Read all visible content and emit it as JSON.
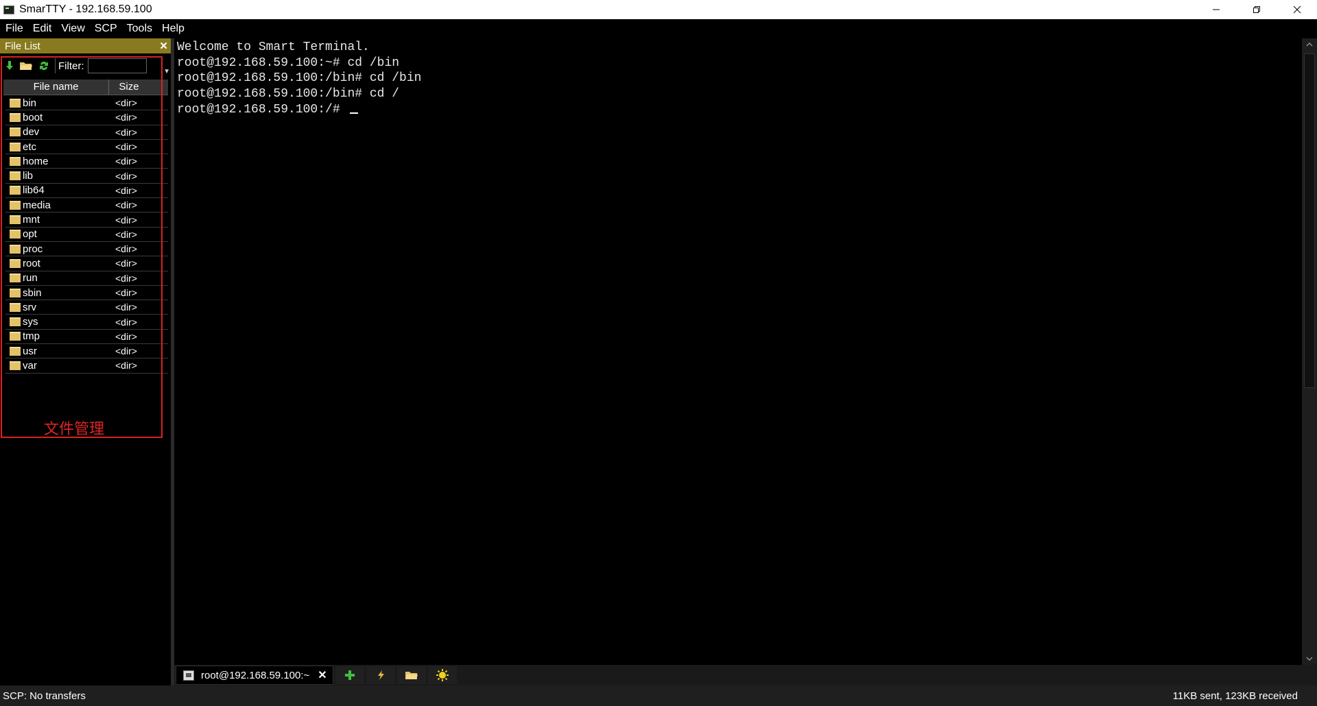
{
  "window": {
    "title": "SmarTTY - 192.168.59.100"
  },
  "menu": [
    "File",
    "Edit",
    "View",
    "SCP",
    "Tools",
    "Help"
  ],
  "file_list": {
    "title": "File List",
    "filter_label": "Filter:",
    "filter_value": "",
    "columns": [
      "File name",
      "Size"
    ],
    "rows": [
      {
        "name": "bin",
        "size": "<dir>"
      },
      {
        "name": "boot",
        "size": "<dir>"
      },
      {
        "name": "dev",
        "size": "<dir>"
      },
      {
        "name": "etc",
        "size": "<dir>"
      },
      {
        "name": "home",
        "size": "<dir>"
      },
      {
        "name": "lib",
        "size": "<dir>"
      },
      {
        "name": "lib64",
        "size": "<dir>"
      },
      {
        "name": "media",
        "size": "<dir>"
      },
      {
        "name": "mnt",
        "size": "<dir>"
      },
      {
        "name": "opt",
        "size": "<dir>"
      },
      {
        "name": "proc",
        "size": "<dir>"
      },
      {
        "name": "root",
        "size": "<dir>"
      },
      {
        "name": "run",
        "size": "<dir>"
      },
      {
        "name": "sbin",
        "size": "<dir>"
      },
      {
        "name": "srv",
        "size": "<dir>"
      },
      {
        "name": "sys",
        "size": "<dir>"
      },
      {
        "name": "tmp",
        "size": "<dir>"
      },
      {
        "name": "usr",
        "size": "<dir>"
      },
      {
        "name": "var",
        "size": "<dir>"
      }
    ]
  },
  "annotation": {
    "text": "文件管理",
    "color": "#e02424"
  },
  "terminal": {
    "lines": [
      "Welcome to Smart Terminal.",
      "root@192.168.59.100:~# cd /bin",
      "root@192.168.59.100:/bin# cd /bin",
      "root@192.168.59.100:/bin# cd /",
      "root@192.168.59.100:/# "
    ]
  },
  "tab": {
    "label": "root@192.168.59.100:~"
  },
  "status": {
    "left": "SCP: No transfers",
    "right": "11KB sent, 123KB received"
  },
  "colors": {
    "file_list_header": "#8a7a1f",
    "folder": "#e4c26a",
    "annotation_border": "#d92222"
  }
}
